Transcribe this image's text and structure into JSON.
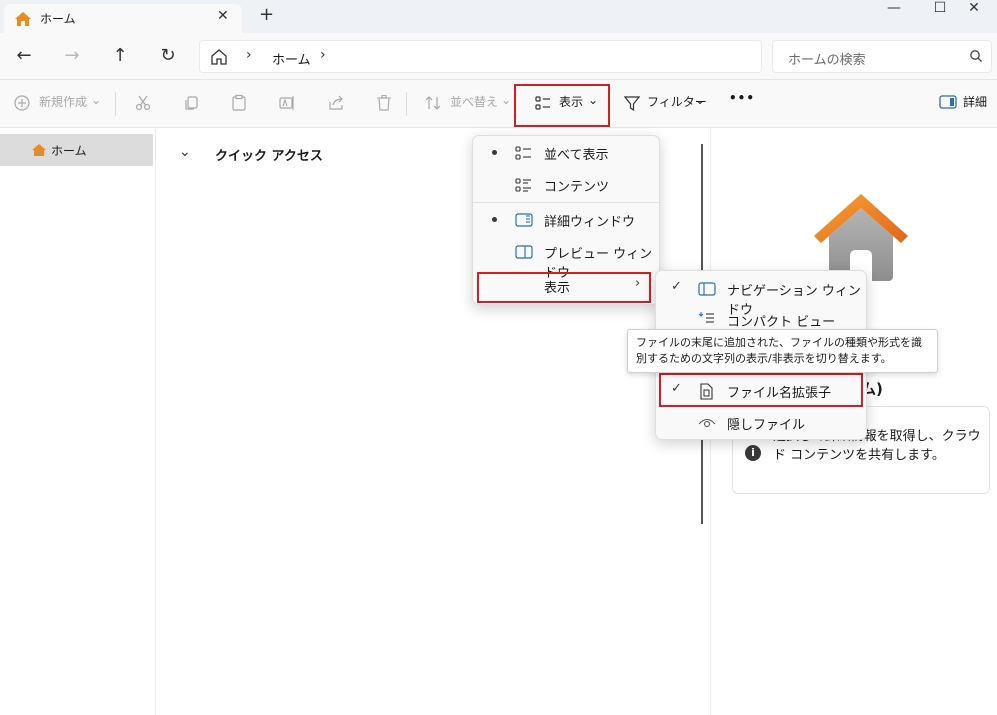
{
  "titlebar": {
    "tab_title": "ホーム",
    "tab_close": "✕",
    "new_tab": "+",
    "minimize": "—",
    "maximize": "☐",
    "close": "✕"
  },
  "navigation": {
    "back": "←",
    "forward": "→",
    "up": "↑",
    "refresh": "↻",
    "breadcrumb_chevron": "›",
    "breadcrumb_location": "ホーム",
    "search_placeholder": "ホームの検索"
  },
  "toolbar": {
    "new_label": "新規作成",
    "sort_label": "並べ替え",
    "view_label": "表示",
    "filter_label": "フィルター",
    "more_label": "•••",
    "details_label": "詳細",
    "caret": "⌄"
  },
  "sidebar": {
    "items": [
      {
        "label": "ホーム"
      }
    ]
  },
  "main": {
    "quick_access_chevron": "⌄",
    "quick_access_title": "クイック アクセス"
  },
  "view_menu": {
    "items": [
      {
        "label": "並べて表示",
        "selected": true,
        "icon": "tiles-icon"
      },
      {
        "label": "コンテンツ",
        "selected": false,
        "icon": "content-icon"
      },
      {
        "label": "詳細ウィンドウ",
        "selected": true,
        "icon": "details-pane-icon"
      },
      {
        "label": "プレビュー ウィンドウ",
        "selected": false,
        "icon": "preview-pane-icon"
      },
      {
        "label": "表示",
        "selected": false,
        "has_submenu": true
      }
    ],
    "submenu_arrow": "›"
  },
  "show_submenu": {
    "items": [
      {
        "label": "ナビゲーション ウィンドウ",
        "checked": true,
        "icon": "nav-pane-icon"
      },
      {
        "label": "コンパクト ビュー",
        "checked": false,
        "icon": "compact-view-icon"
      },
      {
        "label": "ファイル名拡張子",
        "checked": true,
        "icon": "file-extension-icon"
      },
      {
        "label": "隠しファイル",
        "checked": false,
        "icon": "hidden-files-icon"
      }
    ],
    "check_mark": "✓"
  },
  "tooltip": {
    "text": "ファイルの末尾に追加された、ファイルの種類や形式を識別するための文字列の表示/非表示を切り替えます。"
  },
  "details_pane": {
    "title_fragment": "ム)",
    "info_icon": "i",
    "info_text": "選択して詳細情報を取得し、クラウド コンテンツを共有します。"
  },
  "colors": {
    "highlight_border": "#d02027",
    "home_orange": "#f0891e",
    "home_gray": "#9a9a9a",
    "accent_blue": "#2a6fb8"
  }
}
